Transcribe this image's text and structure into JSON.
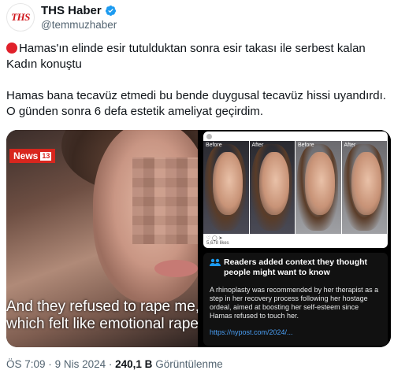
{
  "author": {
    "name": "THS Haber",
    "handle": "@temmuzhaber",
    "avatar_text": "THS"
  },
  "tweet": {
    "line1": "Hamas'ın elinde esir tutulduktan sonra esir takası ile serbest kalan Kadın konuştu",
    "line2": "Hamas bana tecavüz etmedi bu bende duygusal tecavüz hissi uyandırdı. O günden sonra 6 defa estetik ameliyat geçirdim."
  },
  "video": {
    "badge": "News",
    "badge_num": "13",
    "caption": "And they refused to rape me, which felt like emotional rape"
  },
  "instagram": {
    "labels": [
      "Before",
      "After",
      "Before",
      "After"
    ],
    "likes": "5,678 likes"
  },
  "context": {
    "title": "Readers added context they thought people might want to know",
    "body": "A rhinoplasty was recommended by her therapist as a step in her recovery process following her hostage ordeal, aimed at boosting her self-esteem since Hamas refused to touch her.",
    "link": "https://nypost.com/2024/..."
  },
  "meta": {
    "time": "ÖS 7:09",
    "sep": "·",
    "date": "9 Nis 2024",
    "views": "240,1 B",
    "views_label": "Görüntülenme"
  },
  "colors": {
    "verified": "#1d9bf0",
    "red_dot": "#e0202a",
    "link": "#4a9ff5"
  }
}
